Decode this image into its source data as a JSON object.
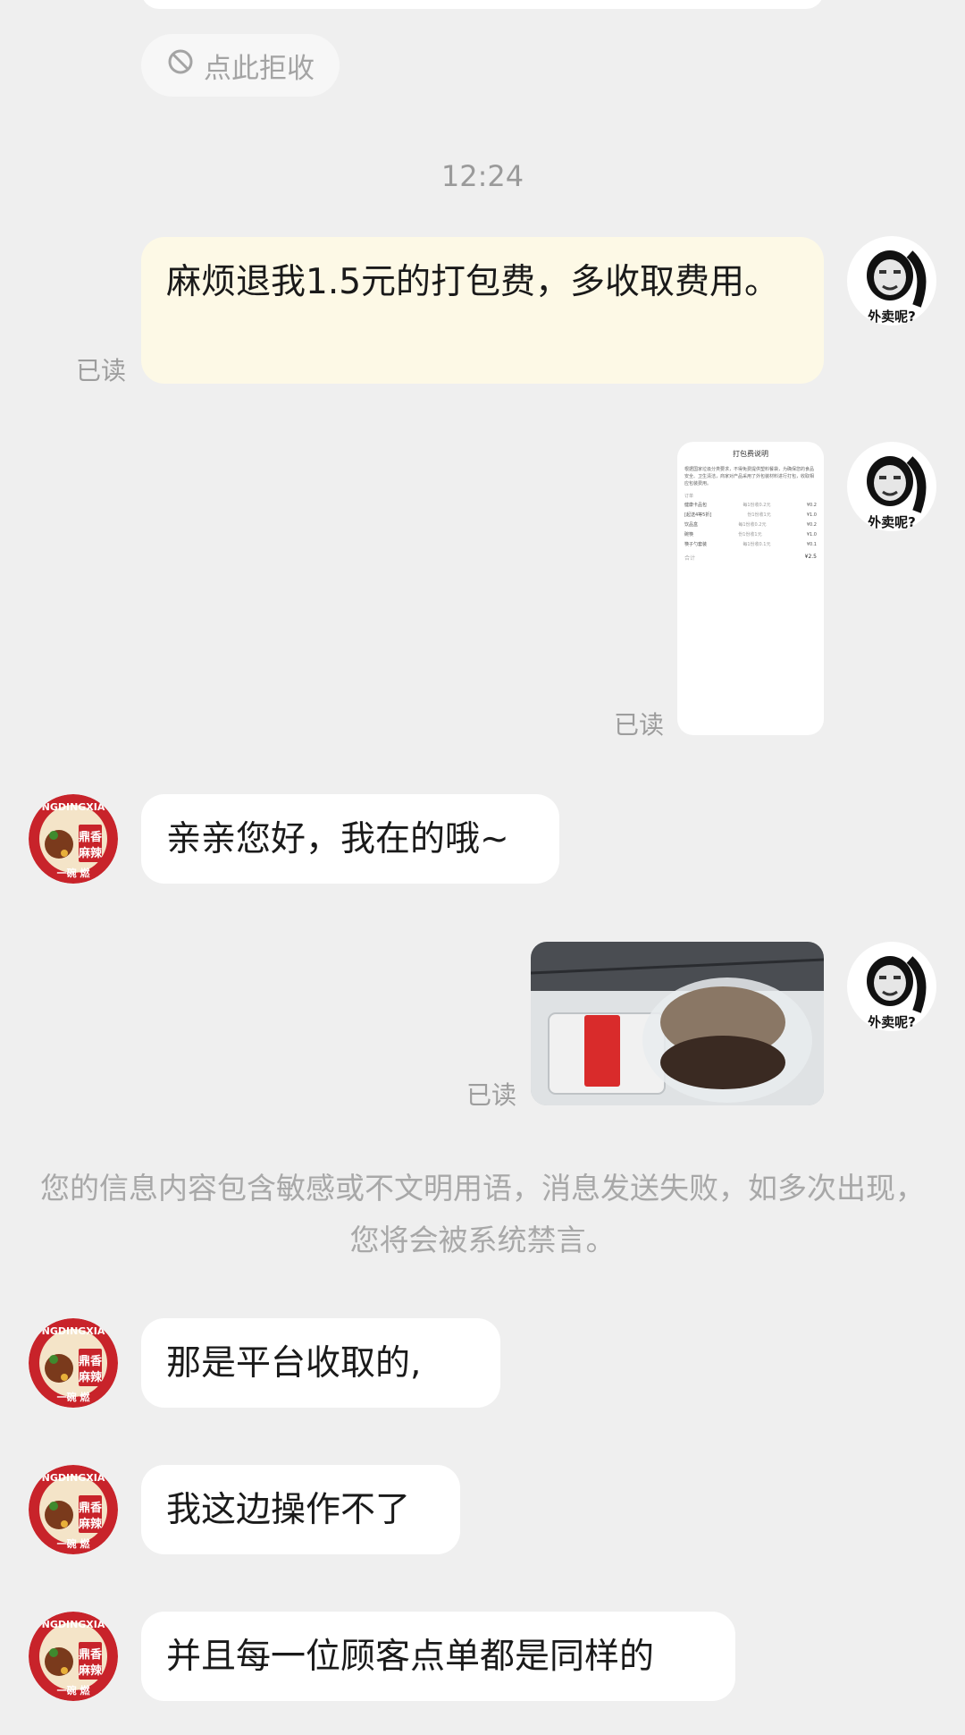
{
  "reject": {
    "label": "点此拒收",
    "icon": "block-icon"
  },
  "timestamp": "12:24",
  "read_label": "已读",
  "messages": {
    "refund_request": "麻烦退我1.5元的打包费，多收取费用。",
    "greeting": "亲亲您好，我在的哦~",
    "platform": "那是平台收取的,",
    "cannot_operate": "我这边操作不了",
    "same_for_all": "并且每一位顾客点单都是同样的"
  },
  "system_notice": "您的信息内容包含敏感或不文明用语，消息发送失败，如多次出现，您将会被系统禁言。",
  "my_avatar_caption": "外卖呢?",
  "shop_avatar": {
    "top_text": "NGDINGXIA",
    "sign_text": "鼎香\n麻辣",
    "bottom_text": "一碗 燃"
  },
  "doc_thumb": {
    "title": "打包费说明",
    "intro": "根据国家垃圾分类要求，不得免费提供塑料餐袋，为确保您的食品安全、卫生清洁，商家对产品采用了外包装材料进行打包，收取相应包装费用。",
    "section_label": "订单",
    "rows": [
      {
        "name": "健康卡品包",
        "note": "每1份收0.2元",
        "price": "¥0.2"
      },
      {
        "name": "[起送4等5折]",
        "note": "份1份收1元",
        "price": "¥1.0"
      },
      {
        "name": "饮品盒",
        "note": "每1份收0.2元",
        "price": "¥0.2"
      },
      {
        "name": "碗筷",
        "note": "份1份收1元",
        "price": "¥1.0"
      },
      {
        "name": "筷子勺套装",
        "note": "每1份收0.1元",
        "price": "¥0.1"
      }
    ],
    "total_label": "合计",
    "total": "¥2.5"
  },
  "colors": {
    "background": "#efefef",
    "my_bubble": "#fdf9e6",
    "other_bubble": "#ffffff",
    "muted_text": "#9d9d9d"
  }
}
